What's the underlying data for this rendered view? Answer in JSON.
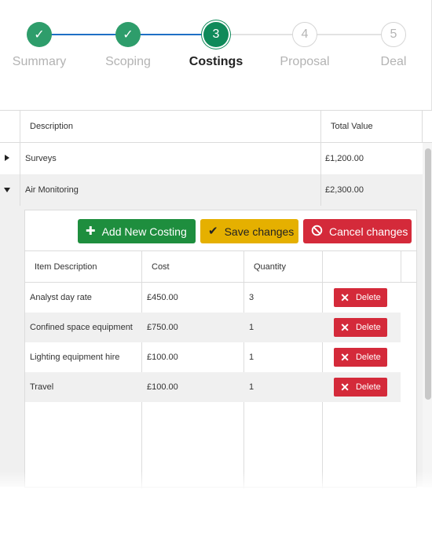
{
  "stepper": {
    "steps": [
      {
        "label": "Summary",
        "state": "done",
        "number": "1"
      },
      {
        "label": "Scoping",
        "state": "done",
        "number": "2"
      },
      {
        "label": "Costings",
        "state": "active",
        "number": "3"
      },
      {
        "label": "Proposal",
        "state": "todo",
        "number": "4"
      },
      {
        "label": "Deal",
        "state": "todo",
        "number": "5"
      }
    ],
    "check_glyph": "✓"
  },
  "grid": {
    "columns": {
      "description": "Description",
      "total_value": "Total Value"
    },
    "rows": [
      {
        "description": "Surveys",
        "total_value": "£1,200.00",
        "expanded": false
      },
      {
        "description": "Air Monitoring",
        "total_value": "£2,300.00",
        "expanded": true
      }
    ]
  },
  "toolbar": {
    "add_label": "Add New Costing",
    "save_label": "Save changes",
    "cancel_label": "Cancel changes"
  },
  "costings": {
    "columns": {
      "item_description": "Item Description",
      "cost": "Cost",
      "quantity": "Quantity"
    },
    "delete_label": "Delete",
    "rows": [
      {
        "item_description": "Analyst day rate",
        "cost": "£450.00",
        "quantity": "3"
      },
      {
        "item_description": "Confined space equipment",
        "cost": "£750.00",
        "quantity": "1"
      },
      {
        "item_description": "Lighting equipment hire",
        "cost": "£100.00",
        "quantity": "1"
      },
      {
        "item_description": "Travel",
        "cost": "£100.00",
        "quantity": "1"
      }
    ]
  },
  "colors": {
    "step_done": "#2e9d6b",
    "step_active": "#0f8a5a",
    "step_line_done": "#1f6fc5",
    "add_button": "#1e8e3e",
    "save_button": "#e5b000",
    "cancel_button": "#d42a3a",
    "delete_button": "#d42a3a"
  }
}
